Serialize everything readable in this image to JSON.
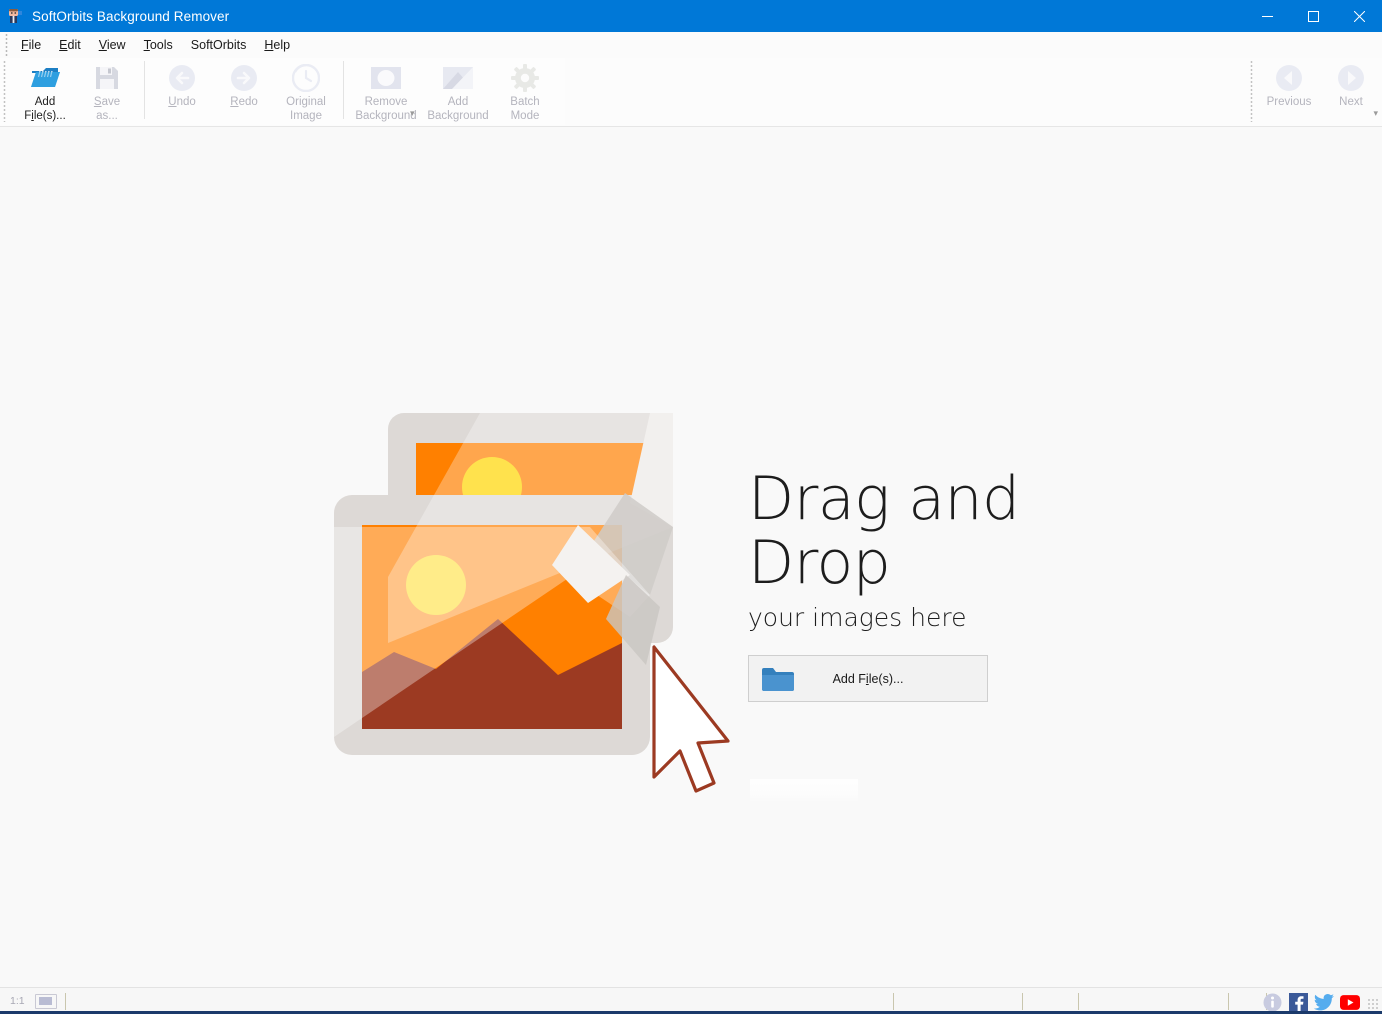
{
  "window": {
    "title": "SoftOrbits Background Remover",
    "app_icon": "app-icon",
    "accent_color": "#0078d7",
    "buttons": {
      "minimize": "—",
      "maximize": "□",
      "close": "✕"
    }
  },
  "menu": {
    "items": [
      {
        "label": "File",
        "accel": "F"
      },
      {
        "label": "Edit",
        "accel": "E"
      },
      {
        "label": "View",
        "accel": "V"
      },
      {
        "label": "Tools",
        "accel": "T"
      },
      {
        "label": "SoftOrbits",
        "accel": ""
      },
      {
        "label": "Help",
        "accel": "H"
      }
    ]
  },
  "toolbar": {
    "groups": [
      {
        "buttons": [
          {
            "label": "Add\nFile(s)...",
            "icon": "open-folder-icon",
            "enabled": true
          },
          {
            "label": "Save\nas...",
            "icon": "floppy-disk-icon",
            "enabled": false
          }
        ]
      },
      {
        "buttons": [
          {
            "label": "Undo",
            "icon": "undo-arrow-icon",
            "enabled": false
          },
          {
            "label": "Redo",
            "icon": "redo-arrow-icon",
            "enabled": false
          },
          {
            "label": "Original\nImage",
            "icon": "clock-history-icon",
            "enabled": false
          }
        ]
      },
      {
        "buttons": [
          {
            "label": "Remove\nBackground",
            "icon": "remove-background-icon",
            "enabled": false
          },
          {
            "label": "Add\nBackground",
            "icon": "add-background-icon",
            "enabled": false
          },
          {
            "label": "Batch\nMode",
            "icon": "gear-icon",
            "enabled": false
          }
        ]
      }
    ],
    "overflow_glyph": "▾",
    "navigation": {
      "buttons": [
        {
          "label": "Previous",
          "icon": "arrow-left-circle-icon",
          "enabled": false
        },
        {
          "label": "Next",
          "icon": "arrow-right-circle-icon",
          "enabled": false
        }
      ],
      "overflow_glyph": "▾"
    }
  },
  "dropzone": {
    "title": "Drag and Drop",
    "subtitle": "your images here",
    "add_files_button": {
      "label_before": "Add F",
      "label_accel": "i",
      "label_after": "le(s)...",
      "icon": "folder-icon"
    },
    "illustration": {
      "name": "two-photos-with-cursor-illustration",
      "colors": {
        "frame": "#ddd9d6",
        "frame_back": "#cfcbc8",
        "sky": "#ff8000",
        "sky_light": "#ff962e",
        "sun": "#ffd600",
        "mountain": "#9c3a22",
        "overlay": "#ffffff",
        "shadow": "#c9c5c2"
      }
    }
  },
  "statusbar": {
    "zoom_label": "1:1",
    "fit_icon": "fit-to-screen-icon",
    "info_icon": "info-icon",
    "social": [
      {
        "name": "facebook-icon",
        "glyph": "f",
        "color": "#3b5998"
      },
      {
        "name": "twitter-icon",
        "glyph": "",
        "color": "#55acee"
      },
      {
        "name": "youtube-icon",
        "glyph": "▶",
        "color": "#ff0000"
      }
    ],
    "resize_grip": "resize-grip-icon"
  }
}
